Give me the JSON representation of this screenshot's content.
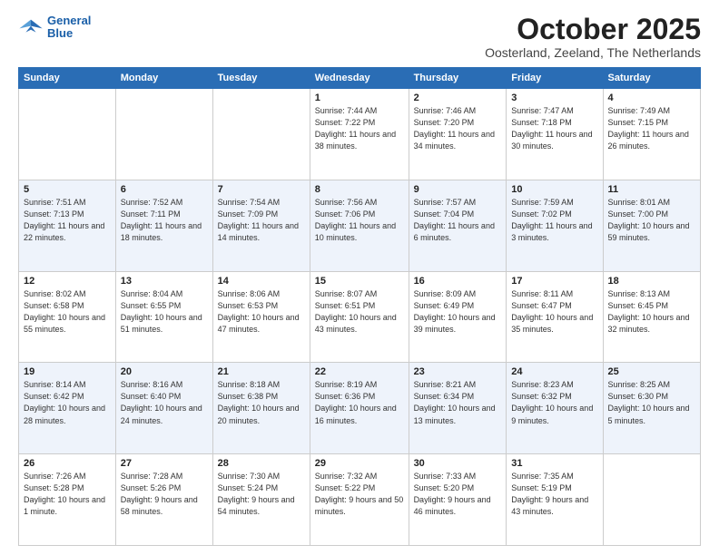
{
  "logo": {
    "line1": "General",
    "line2": "Blue"
  },
  "title": "October 2025",
  "location": "Oosterland, Zeeland, The Netherlands",
  "days_of_week": [
    "Sunday",
    "Monday",
    "Tuesday",
    "Wednesday",
    "Thursday",
    "Friday",
    "Saturday"
  ],
  "weeks": [
    [
      {
        "day": "",
        "info": ""
      },
      {
        "day": "",
        "info": ""
      },
      {
        "day": "",
        "info": ""
      },
      {
        "day": "1",
        "info": "Sunrise: 7:44 AM\nSunset: 7:22 PM\nDaylight: 11 hours\nand 38 minutes."
      },
      {
        "day": "2",
        "info": "Sunrise: 7:46 AM\nSunset: 7:20 PM\nDaylight: 11 hours\nand 34 minutes."
      },
      {
        "day": "3",
        "info": "Sunrise: 7:47 AM\nSunset: 7:18 PM\nDaylight: 11 hours\nand 30 minutes."
      },
      {
        "day": "4",
        "info": "Sunrise: 7:49 AM\nSunset: 7:15 PM\nDaylight: 11 hours\nand 26 minutes."
      }
    ],
    [
      {
        "day": "5",
        "info": "Sunrise: 7:51 AM\nSunset: 7:13 PM\nDaylight: 11 hours\nand 22 minutes."
      },
      {
        "day": "6",
        "info": "Sunrise: 7:52 AM\nSunset: 7:11 PM\nDaylight: 11 hours\nand 18 minutes."
      },
      {
        "day": "7",
        "info": "Sunrise: 7:54 AM\nSunset: 7:09 PM\nDaylight: 11 hours\nand 14 minutes."
      },
      {
        "day": "8",
        "info": "Sunrise: 7:56 AM\nSunset: 7:06 PM\nDaylight: 11 hours\nand 10 minutes."
      },
      {
        "day": "9",
        "info": "Sunrise: 7:57 AM\nSunset: 7:04 PM\nDaylight: 11 hours\nand 6 minutes."
      },
      {
        "day": "10",
        "info": "Sunrise: 7:59 AM\nSunset: 7:02 PM\nDaylight: 11 hours\nand 3 minutes."
      },
      {
        "day": "11",
        "info": "Sunrise: 8:01 AM\nSunset: 7:00 PM\nDaylight: 10 hours\nand 59 minutes."
      }
    ],
    [
      {
        "day": "12",
        "info": "Sunrise: 8:02 AM\nSunset: 6:58 PM\nDaylight: 10 hours\nand 55 minutes."
      },
      {
        "day": "13",
        "info": "Sunrise: 8:04 AM\nSunset: 6:55 PM\nDaylight: 10 hours\nand 51 minutes."
      },
      {
        "day": "14",
        "info": "Sunrise: 8:06 AM\nSunset: 6:53 PM\nDaylight: 10 hours\nand 47 minutes."
      },
      {
        "day": "15",
        "info": "Sunrise: 8:07 AM\nSunset: 6:51 PM\nDaylight: 10 hours\nand 43 minutes."
      },
      {
        "day": "16",
        "info": "Sunrise: 8:09 AM\nSunset: 6:49 PM\nDaylight: 10 hours\nand 39 minutes."
      },
      {
        "day": "17",
        "info": "Sunrise: 8:11 AM\nSunset: 6:47 PM\nDaylight: 10 hours\nand 35 minutes."
      },
      {
        "day": "18",
        "info": "Sunrise: 8:13 AM\nSunset: 6:45 PM\nDaylight: 10 hours\nand 32 minutes."
      }
    ],
    [
      {
        "day": "19",
        "info": "Sunrise: 8:14 AM\nSunset: 6:42 PM\nDaylight: 10 hours\nand 28 minutes."
      },
      {
        "day": "20",
        "info": "Sunrise: 8:16 AM\nSunset: 6:40 PM\nDaylight: 10 hours\nand 24 minutes."
      },
      {
        "day": "21",
        "info": "Sunrise: 8:18 AM\nSunset: 6:38 PM\nDaylight: 10 hours\nand 20 minutes."
      },
      {
        "day": "22",
        "info": "Sunrise: 8:19 AM\nSunset: 6:36 PM\nDaylight: 10 hours\nand 16 minutes."
      },
      {
        "day": "23",
        "info": "Sunrise: 8:21 AM\nSunset: 6:34 PM\nDaylight: 10 hours\nand 13 minutes."
      },
      {
        "day": "24",
        "info": "Sunrise: 8:23 AM\nSunset: 6:32 PM\nDaylight: 10 hours\nand 9 minutes."
      },
      {
        "day": "25",
        "info": "Sunrise: 8:25 AM\nSunset: 6:30 PM\nDaylight: 10 hours\nand 5 minutes."
      }
    ],
    [
      {
        "day": "26",
        "info": "Sunrise: 7:26 AM\nSunset: 5:28 PM\nDaylight: 10 hours\nand 1 minute."
      },
      {
        "day": "27",
        "info": "Sunrise: 7:28 AM\nSunset: 5:26 PM\nDaylight: 9 hours\nand 58 minutes."
      },
      {
        "day": "28",
        "info": "Sunrise: 7:30 AM\nSunset: 5:24 PM\nDaylight: 9 hours\nand 54 minutes."
      },
      {
        "day": "29",
        "info": "Sunrise: 7:32 AM\nSunset: 5:22 PM\nDaylight: 9 hours\nand 50 minutes."
      },
      {
        "day": "30",
        "info": "Sunrise: 7:33 AM\nSunset: 5:20 PM\nDaylight: 9 hours\nand 46 minutes."
      },
      {
        "day": "31",
        "info": "Sunrise: 7:35 AM\nSunset: 5:19 PM\nDaylight: 9 hours\nand 43 minutes."
      },
      {
        "day": "",
        "info": ""
      }
    ]
  ]
}
